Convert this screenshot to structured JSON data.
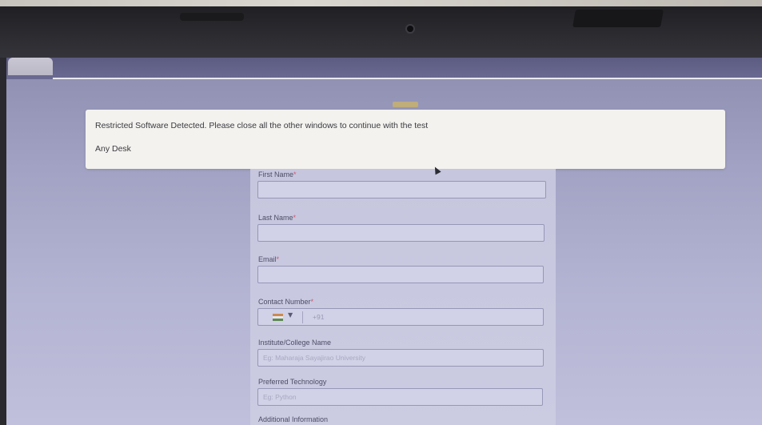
{
  "alert": {
    "message": "Restricted Software Detected. Please close all the other windows to continue with the test",
    "app": "Any Desk"
  },
  "form": {
    "first_name": {
      "label": "First Name",
      "required": "*",
      "value": ""
    },
    "last_name": {
      "label": "Last Name",
      "required": "*",
      "value": ""
    },
    "email": {
      "label": "Email",
      "required": "*",
      "value": ""
    },
    "contact": {
      "label": "Contact Number",
      "required": "*",
      "dial_code": "+91",
      "country_flag": "india-flag-icon"
    },
    "institute": {
      "label": "Institute/College Name",
      "placeholder": "Eg: Maharaja Sayajirao University"
    },
    "technology": {
      "label": "Preferred Technology",
      "placeholder": "Eg: Python"
    },
    "additional": {
      "label": "Additional Information"
    }
  },
  "colors": {
    "screen_bg": "#a2a2c4",
    "alert_bg": "#f3f2ee",
    "required_marker": "#d0586e"
  }
}
